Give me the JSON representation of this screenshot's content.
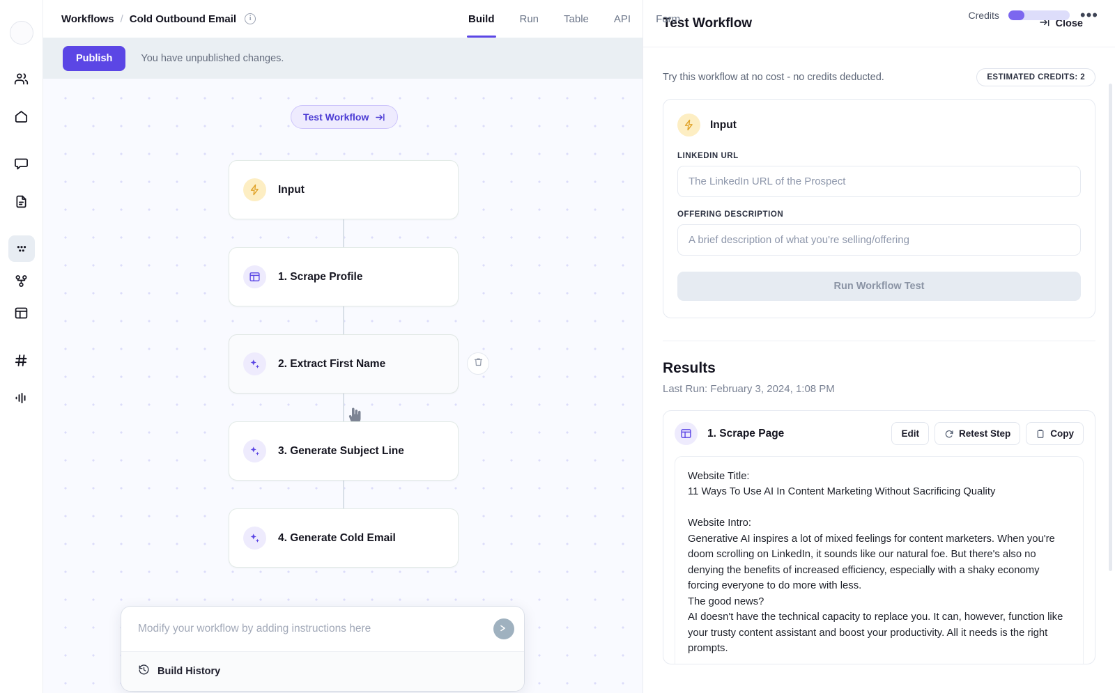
{
  "app": {
    "breadcrumb_root": "Workflows",
    "breadcrumb_sep": "/",
    "breadcrumb_current": "Cold Outbound Email",
    "info_icon_glyph": "i"
  },
  "tabs": [
    {
      "label": "Build",
      "active": true
    },
    {
      "label": "Run",
      "active": false
    },
    {
      "label": "Table",
      "active": false
    },
    {
      "label": "API",
      "active": false
    },
    {
      "label": "Form",
      "active": false
    }
  ],
  "credits": {
    "label": "Credits",
    "fill_percent": 26,
    "accent": "#7c67ef",
    "track": "#ddddfa",
    "more_glyph": "•••"
  },
  "sidebar": {
    "items": [
      {
        "name": "people-icon",
        "active": false
      },
      {
        "name": "home-icon",
        "active": false
      },
      {
        "name": "chat-icon",
        "active": false
      },
      {
        "name": "document-icon",
        "active": false
      },
      {
        "name": "apps-dots-icon",
        "active": true
      },
      {
        "name": "workflow-nodes-icon",
        "active": false
      },
      {
        "name": "layout-icon",
        "active": false
      },
      {
        "name": "hash-icon",
        "active": false
      },
      {
        "name": "analytics-icon",
        "active": false
      }
    ]
  },
  "banner": {
    "publish_label": "Publish",
    "message": "You have unpublished changes.",
    "publish_color": "#5b46e5"
  },
  "canvas": {
    "test_pill_label": "Test Workflow",
    "nodes": [
      {
        "label": "Input",
        "icon": "bolt-icon",
        "tone": "amber",
        "hovered": false
      },
      {
        "label": "1. Scrape Profile",
        "icon": "layout-panel-icon",
        "tone": "violet",
        "hovered": false
      },
      {
        "label": "2. Extract First Name",
        "icon": "sparkle-icon",
        "tone": "violet",
        "hovered": true
      },
      {
        "label": "3. Generate Subject Line",
        "icon": "sparkle-icon",
        "tone": "violet",
        "hovered": false
      },
      {
        "label": "4. Generate Cold Email",
        "icon": "sparkle-icon",
        "tone": "violet",
        "hovered": false
      }
    ],
    "prompt_placeholder": "Modify your workflow by adding instructions here",
    "prompt_value": "",
    "build_history_label": "Build History"
  },
  "panel": {
    "title": "Test Workflow",
    "close_label": "Close",
    "try_text": "Try this workflow at no cost - no credits deducted.",
    "estimated_credits_badge": "ESTIMATED CREDITS: 2",
    "input_card": {
      "title": "Input",
      "fields": [
        {
          "label": "LINKEDIN URL",
          "placeholder": "The LinkedIn URL of the Prospect",
          "value": ""
        },
        {
          "label": "OFFERING DESCRIPTION",
          "placeholder": "A brief description of what you're selling/offering",
          "value": ""
        }
      ],
      "run_button_label": "Run Workflow Test"
    },
    "results": {
      "heading": "Results",
      "last_run": "Last Run: February 3, 2024, 1:08 PM",
      "card": {
        "step_title": "1. Scrape Page",
        "actions": [
          {
            "label": "Edit",
            "icon": "none"
          },
          {
            "label": "Retest Step",
            "icon": "refresh-icon"
          },
          {
            "label": "Copy",
            "icon": "clipboard-icon"
          }
        ],
        "output": "Website Title:\n11 Ways To Use AI In Content Marketing Without Sacrificing Quality\n\nWebsite Intro:\nGenerative AI inspires a lot of mixed feelings for content marketers. When you're doom scrolling on LinkedIn, it sounds like our natural foe. But there's also no denying the benefits of increased efficiency, especially with a shaky economy forcing everyone to do more with less.\nThe good news?\nAI doesn't have the technical capacity to replace you. It can, however, function like your trusty content assistant and boost your productivity. All it needs is the right prompts."
      }
    }
  }
}
